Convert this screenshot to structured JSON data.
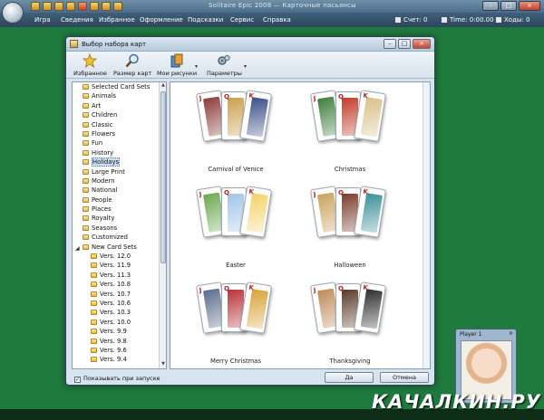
{
  "app": {
    "title": "Solitaire Epic 2008 — Карточные пасьянсы",
    "menu": [
      "Игра",
      "Сведения",
      "Избранное",
      "Оформление",
      "Подсказки",
      "Сервис",
      "Справка"
    ],
    "stats": {
      "score": "Счет: 0",
      "time": "Time: 0:00.00",
      "moves": "Ходы: 0"
    }
  },
  "dialog": {
    "title": "Выбор набора карт",
    "toolbar": [
      {
        "label": "Избранное",
        "icon": "star-icon"
      },
      {
        "label": "Размер карт",
        "icon": "magnifier-icon"
      },
      {
        "label": "Мои рисунки",
        "icon": "pictures-icon"
      },
      {
        "label": "Параметры",
        "icon": "gears-icon"
      }
    ],
    "tree": [
      {
        "label": "Selected Card Sets",
        "level": 0
      },
      {
        "label": "Animals",
        "level": 0
      },
      {
        "label": "Art",
        "level": 0
      },
      {
        "label": "Children",
        "level": 0
      },
      {
        "label": "Classic",
        "level": 0
      },
      {
        "label": "Flowers",
        "level": 0
      },
      {
        "label": "Fun",
        "level": 0
      },
      {
        "label": "History",
        "level": 0
      },
      {
        "label": "Holidays",
        "level": 0,
        "selected": true
      },
      {
        "label": "Large Print",
        "level": 0
      },
      {
        "label": "Modern",
        "level": 0
      },
      {
        "label": "National",
        "level": 0
      },
      {
        "label": "People",
        "level": 0
      },
      {
        "label": "Places",
        "level": 0
      },
      {
        "label": "Royalty",
        "level": 0
      },
      {
        "label": "Seasons",
        "level": 0
      },
      {
        "label": "Customized",
        "level": 0
      },
      {
        "label": "New Card Sets",
        "level": 0,
        "expanded": true
      },
      {
        "label": "Vers. 12.0",
        "level": 1
      },
      {
        "label": "Vers. 11.9",
        "level": 1
      },
      {
        "label": "Vers. 11.3",
        "level": 1
      },
      {
        "label": "Vers. 10.8",
        "level": 1
      },
      {
        "label": "Vers. 10.7",
        "level": 1
      },
      {
        "label": "Vers. 10.6",
        "level": 1
      },
      {
        "label": "Vers. 10.3",
        "level": 1
      },
      {
        "label": "Vers. 10.0",
        "level": 1
      },
      {
        "label": "Vers. 9.9",
        "level": 1
      },
      {
        "label": "Vers. 9.8",
        "level": 1
      },
      {
        "label": "Vers. 9.6",
        "level": 1
      },
      {
        "label": "Vers. 9.4",
        "level": 1
      }
    ],
    "decks": [
      {
        "label": "Carnival of Venice",
        "colors": [
          "#8b3a3a",
          "#c9a04a",
          "#3b4f8a"
        ]
      },
      {
        "label": "Christmas",
        "colors": [
          "#3f7d3a",
          "#c33a2a",
          "#d8c08a"
        ]
      },
      {
        "label": "Easter",
        "colors": [
          "#6aa84f",
          "#9fc5e8",
          "#f3d36b"
        ]
      },
      {
        "label": "Halloween",
        "colors": [
          "#c9a25a",
          "#7b3b2c",
          "#3d8f9a"
        ]
      },
      {
        "label": "Merry Christmas",
        "colors": [
          "#5a6b8a",
          "#b8323a",
          "#d9a33a"
        ]
      },
      {
        "label": "Thanksgiving",
        "colors": [
          "#c08a5a",
          "#5a3a2a",
          "#2f2f2f"
        ]
      }
    ],
    "checkbox_label": "Показывать при запуске",
    "checkbox_checked": true,
    "ok_label": "Да",
    "cancel_label": "Отмена"
  },
  "player": {
    "title": "Player 1"
  },
  "watermark": "КАЧАЛКИН.РУ"
}
